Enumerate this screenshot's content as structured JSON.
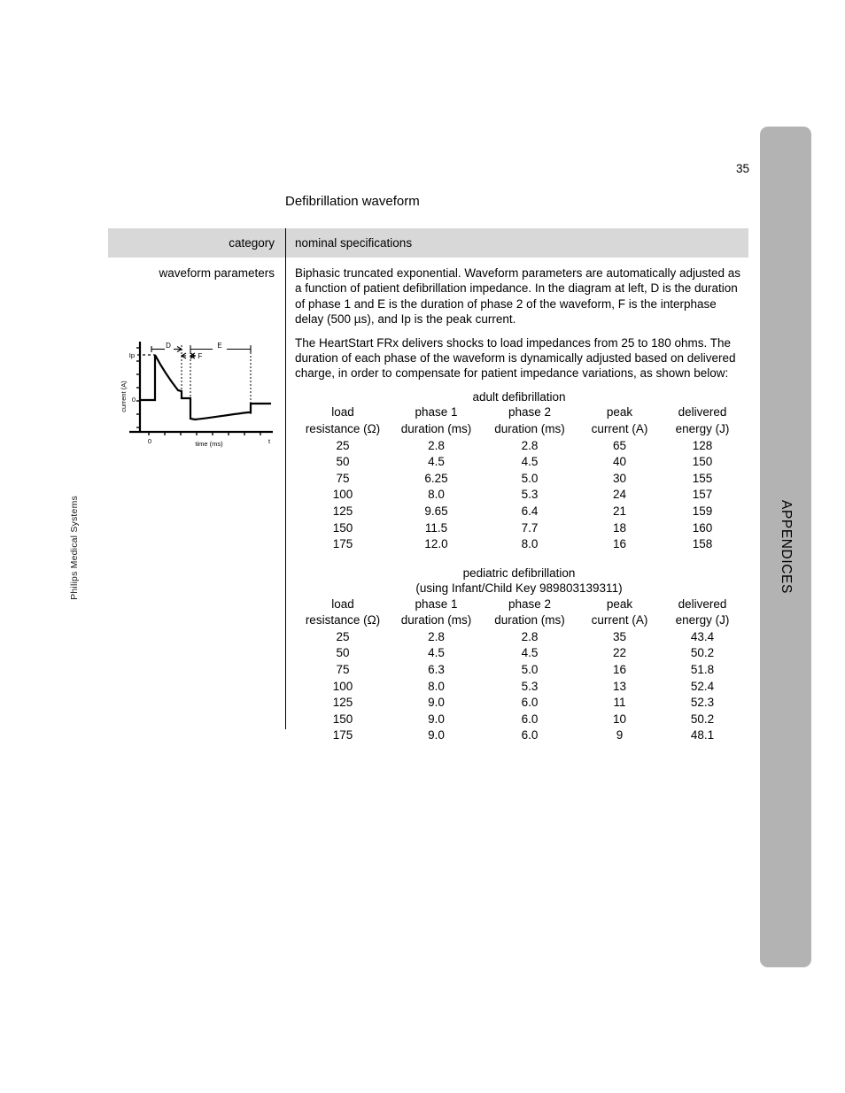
{
  "page": {
    "number": "35",
    "side_tab_label": "APPENDICES",
    "brand": "Philips Medical Systems",
    "section_title": "Defibrillation waveform",
    "colors": {
      "side_tab": "#b3b3b3",
      "table_header_band": "#d8d8d8",
      "rule": "#000000",
      "text": "#000000"
    }
  },
  "spec_table": {
    "headers": {
      "category": "category",
      "nominal": "nominal specifications"
    },
    "row": {
      "category": "waveform parameters",
      "paragraphs": [
        "Biphasic truncated exponential. Waveform parameters are automatically adjusted as a function of patient defibrillation impedance. In the diagram at left, D is the duration of phase 1 and E is the duration of phase 2 of the waveform, F is the interphase delay (500 µs), and Ip is the peak current.",
        "The HeartStart FRx delivers shocks to load impedances from 25 to 180 ohms. The duration of each phase of the waveform is dynamically adjusted based on delivered charge, in order to compensate for patient impedance variations, as shown below:"
      ]
    }
  },
  "waveform_figure": {
    "y_axis_label": "current (A)",
    "x_axis_label": "time (ms)",
    "peak_label": "Ip",
    "zero_label": "0",
    "origin_label": "0",
    "t_label": "t",
    "phase1_label": "D",
    "phase2_label": "E",
    "interphase_label": "F"
  },
  "chart_data": {
    "type": "table",
    "tables": [
      {
        "title": "adult defibrillation",
        "subtitle": "",
        "columns": [
          "load\nresistance (Ω)",
          "phase 1\nduration (ms)",
          "phase 2\nduration (ms)",
          "peak\ncurrent (A)",
          "delivered\nenergy (J)"
        ],
        "column_lines": [
          [
            "load",
            "resistance (Ω)"
          ],
          [
            "phase 1",
            "duration (ms)"
          ],
          [
            "phase 2",
            "duration (ms)"
          ],
          [
            "peak",
            "current (A)"
          ],
          [
            "delivered",
            "energy (J)"
          ]
        ],
        "rows": [
          [
            "25",
            "2.8",
            "2.8",
            "65",
            "128"
          ],
          [
            "50",
            "4.5",
            "4.5",
            "40",
            "150"
          ],
          [
            "75",
            "6.25",
            "5.0",
            "30",
            "155"
          ],
          [
            "100",
            "8.0",
            "5.3",
            "24",
            "157"
          ],
          [
            "125",
            "9.65",
            "6.4",
            "21",
            "159"
          ],
          [
            "150",
            "11.5",
            "7.7",
            "18",
            "160"
          ],
          [
            "175",
            "12.0",
            "8.0",
            "16",
            "158"
          ]
        ]
      },
      {
        "title": "pediatric defibrillation",
        "subtitle": "(using Infant/Child Key 989803139311)",
        "columns": [
          "load\nresistance (Ω)",
          "phase 1\nduration (ms)",
          "phase 2\nduration (ms)",
          "peak\ncurrent (A)",
          "delivered\nenergy (J)"
        ],
        "column_lines": [
          [
            "load",
            "resistance (Ω)"
          ],
          [
            "phase 1",
            "duration (ms)"
          ],
          [
            "phase 2",
            "duration (ms)"
          ],
          [
            "peak",
            "current (A)"
          ],
          [
            "delivered",
            "energy (J)"
          ]
        ],
        "rows": [
          [
            "25",
            "2.8",
            "2.8",
            "35",
            "43.4"
          ],
          [
            "50",
            "4.5",
            "4.5",
            "22",
            "50.2"
          ],
          [
            "75",
            "6.3",
            "5.0",
            "16",
            "51.8"
          ],
          [
            "100",
            "8.0",
            "5.3",
            "13",
            "52.4"
          ],
          [
            "125",
            "9.0",
            "6.0",
            "11",
            "52.3"
          ],
          [
            "150",
            "9.0",
            "6.0",
            "10",
            "50.2"
          ],
          [
            "175",
            "9.0",
            "6.0",
            "9",
            "48.1"
          ]
        ]
      }
    ]
  }
}
